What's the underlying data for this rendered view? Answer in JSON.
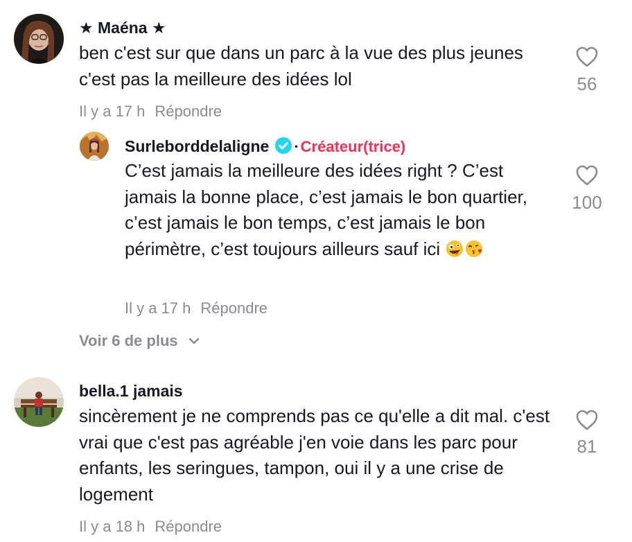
{
  "comments": [
    {
      "username": "★ Maéna ★",
      "text": "ben c'est sur que dans un parc à la vue des plus jeunes c'est pas la meilleure des idées lol",
      "time": "Il y a 17 h",
      "reply_label": "Répondre",
      "likes": "56",
      "avatar_icon": "avatar-photo-woman-glasses"
    },
    {
      "username": "bella.1 jamais",
      "text": "sincèrement je ne comprends pas ce qu'elle a dit mal. c'est vrai que c'est pas agréable j'en voie dans les parc pour enfants, les seringues, tampon, oui il y a une crise de logement",
      "time": "Il y a 18 h",
      "reply_label": "Répondre",
      "likes": "81",
      "avatar_icon": "avatar-photo-child-bench"
    }
  ],
  "reply": {
    "username": "Surlebord delaligne",
    "username_display": "Surleborddelaligne",
    "badge_separator": "·",
    "creator_label": "Créateur(trice)",
    "text": "C’est jamais la meilleure des idées right ? C’est jamais la bonne place, c’est jamais le bon quartier, c’est jamais le bon temps, c’est jamais le bon périmètre, c’est toujours ailleurs sauf ici",
    "time": "Il y a 17 h",
    "reply_label": "Répondre",
    "likes": "100",
    "emojis": [
      "zany-face-emoji",
      "kissing-face-emoji"
    ],
    "verified_icon": "verified-check-icon"
  },
  "view_more": {
    "label": "Voir 6 de plus",
    "icon": "chevron-down-icon"
  },
  "colors": {
    "text": "#161823",
    "secondary": "#8a8b91",
    "creator": "#fe2c55",
    "verified": "#20d5ec"
  }
}
